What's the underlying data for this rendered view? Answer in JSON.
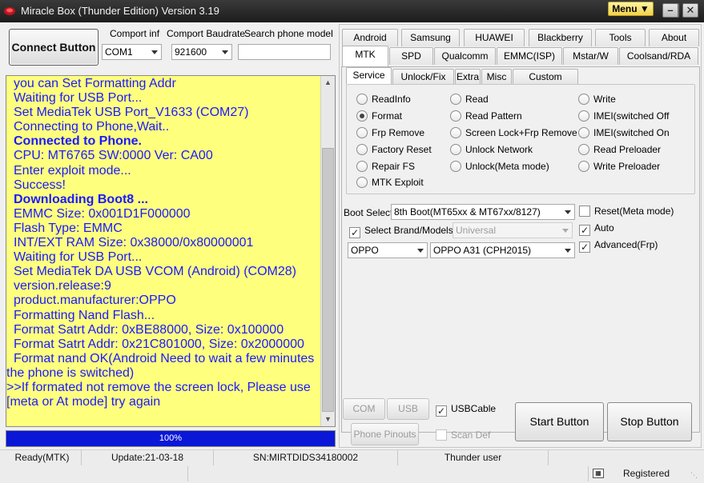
{
  "window": {
    "title": "Miracle Box (Thunder Edition) Version 3.19",
    "menu_label": "Menu",
    "controls": [
      "−",
      "□",
      "✕"
    ]
  },
  "connect": {
    "button_label": "Connect Button",
    "comport_label": "Comport inf",
    "comport_value": "COM1",
    "baud_label": "Comport Baudrate",
    "baud_value": "921600",
    "search_label": "Search phone model",
    "search_value": ""
  },
  "log": [
    {
      "text": "you can Set Formatting Addr",
      "indent": true,
      "bold": false
    },
    {
      "text": "Waiting for USB Port...",
      "indent": true,
      "bold": false
    },
    {
      "text": "Set MediaTek USB Port_V1633 (COM27)",
      "indent": true,
      "bold": false
    },
    {
      "text": "Connecting to Phone,Wait..",
      "indent": true,
      "bold": false
    },
    {
      "text": "Connected to Phone.",
      "indent": true,
      "bold": true
    },
    {
      "text": "CPU: MT6765 SW:0000 Ver: CA00",
      "indent": true,
      "bold": false
    },
    {
      "text": "Enter exploit mode...",
      "indent": true,
      "bold": false
    },
    {
      "text": "Success!",
      "indent": true,
      "bold": false
    },
    {
      "text": "Downloading Boot8 ...",
      "indent": true,
      "bold": true
    },
    {
      "text": "EMMC Size: 0x001D1F000000",
      "indent": true,
      "bold": false
    },
    {
      "text": "Flash Type: EMMC",
      "indent": true,
      "bold": false
    },
    {
      "text": "INT/EXT RAM  Size: 0x38000/0x80000001",
      "indent": true,
      "bold": false
    },
    {
      "text": "Waiting for USB Port...",
      "indent": true,
      "bold": false
    },
    {
      "text": "Set MediaTek DA USB VCOM (Android) (COM28)",
      "indent": true,
      "bold": false
    },
    {
      "text": "version.release:9",
      "indent": true,
      "bold": false
    },
    {
      "text": "product.manufacturer:OPPO",
      "indent": true,
      "bold": false
    },
    {
      "text": "Formatting Nand Flash...",
      "indent": true,
      "bold": false
    },
    {
      "text": "Format Satrt Addr: 0xBE88000, Size: 0x100000",
      "indent": true,
      "bold": false
    },
    {
      "text": "Format Satrt Addr: 0x21C801000, Size: 0x2000000",
      "indent": true,
      "bold": false
    },
    {
      "text": " Format nand OK(Android Need to wait a few minutes",
      "indent": true,
      "bold": false
    },
    {
      "text": "the phone is switched)",
      "indent": false,
      "bold": false
    },
    {
      "text": ">>If formated not remove the screen lock, Please use",
      "indent": false,
      "bold": false
    },
    {
      "text": "[meta or At mode] try again",
      "indent": false,
      "bold": false
    }
  ],
  "progress": {
    "value": 1.0,
    "label": "100%",
    "color": "#0a17d6"
  },
  "tabs_row1": [
    "Android",
    "Samsung",
    "HUAWEI",
    "Blackberry",
    "Tools",
    "About"
  ],
  "tabs_row2": [
    "MTK",
    "SPD",
    "Qualcomm",
    "EMMC(ISP)",
    "Mstar/W",
    "Coolsand/RDA"
  ],
  "active_tab": "MTK",
  "subtabs": [
    "Service",
    "Unlock/Fix",
    "Extra",
    "Misc",
    "Custom Setting"
  ],
  "active_subtab": "Service",
  "radios": {
    "col1": [
      "ReadInfo",
      "Format",
      "Frp Remove",
      "Factory Reset",
      "Repair FS",
      "MTK Exploit"
    ],
    "col2": [
      "Read",
      "Read Pattern",
      "Screen Lock+Frp Remove",
      "Unlock Network",
      "Unlock(Meta mode)"
    ],
    "col3": [
      "Write",
      "IMEI(switched Off",
      "IMEI(switched On",
      "Read Preloader",
      "Write Preloader"
    ],
    "selected": "Format"
  },
  "boot": {
    "label": "Boot Select:",
    "value": "8th Boot(MT65xx & MT67xx/8127)"
  },
  "brand": {
    "select_label": "Select Brand/Models",
    "select_checked": true,
    "universal_value": "Universal",
    "brand_value": "OPPO",
    "model_value": "OPPO A31 (CPH2015)"
  },
  "options": {
    "reset_meta": {
      "label": "Reset(Meta mode)",
      "checked": false
    },
    "auto": {
      "label": "Auto",
      "checked": true
    },
    "advanced_frp": {
      "label": "Advanced(Frp)",
      "checked": true
    }
  },
  "bottom": {
    "com_scan": "COM Scan",
    "usb_scan": "USB Scan",
    "usb_cable": "USBCable",
    "usb_cable_checked": true,
    "phone_pinouts": "Phone Pinouts",
    "scan_def": "Scan Def",
    "start": "Start Button",
    "stop": "Stop Button"
  },
  "status": {
    "state": "Ready(MTK)",
    "update": "Update:21-03-18",
    "sn": "SN:MIRTDIDS34180002",
    "user": "Thunder user",
    "registered": "Registered"
  }
}
